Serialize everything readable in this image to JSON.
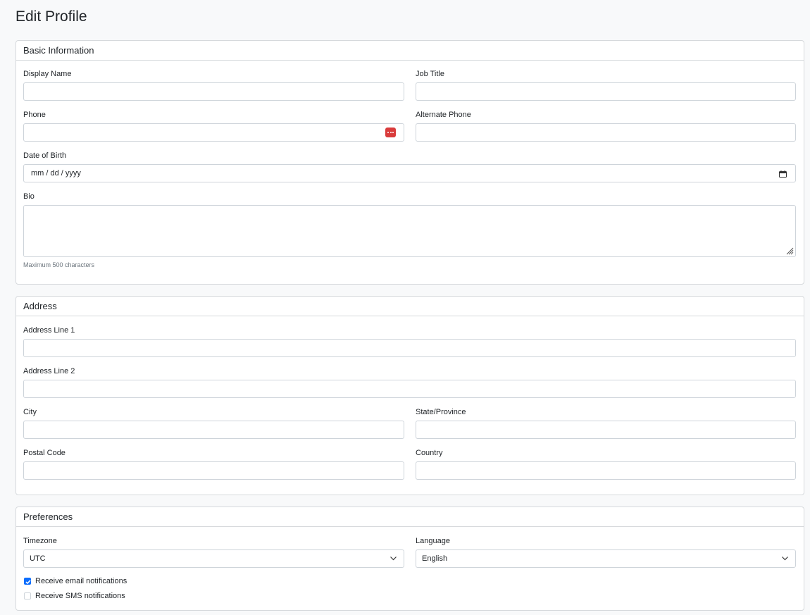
{
  "page": {
    "title": "Edit Profile"
  },
  "basic": {
    "header": "Basic Information",
    "display_name": {
      "label": "Display Name",
      "value": ""
    },
    "job_title": {
      "label": "Job Title",
      "value": ""
    },
    "phone": {
      "label": "Phone",
      "value": "",
      "icon": "password-manager-icon"
    },
    "alt_phone": {
      "label": "Alternate Phone",
      "value": ""
    },
    "dob": {
      "label": "Date of Birth",
      "placeholder": "mm / dd / yyyy",
      "icon": "calendar-icon"
    },
    "bio": {
      "label": "Bio",
      "value": "",
      "help": "Maximum 500 characters"
    }
  },
  "address": {
    "header": "Address",
    "line1": {
      "label": "Address Line 1",
      "value": ""
    },
    "line2": {
      "label": "Address Line 2",
      "value": ""
    },
    "city": {
      "label": "City",
      "value": ""
    },
    "state": {
      "label": "State/Province",
      "value": ""
    },
    "postal": {
      "label": "Postal Code",
      "value": ""
    },
    "country": {
      "label": "Country",
      "value": ""
    }
  },
  "prefs": {
    "header": "Preferences",
    "timezone": {
      "label": "Timezone",
      "value": "UTC"
    },
    "language": {
      "label": "Language",
      "value": "English"
    },
    "email_notif": {
      "label": "Receive email notifications",
      "checked": true
    },
    "sms_notif": {
      "label": "Receive SMS notifications",
      "checked": false
    }
  },
  "colors": {
    "accent": "#0d6efd",
    "password_manager": "#d93b3b",
    "border": "#ced4da"
  }
}
